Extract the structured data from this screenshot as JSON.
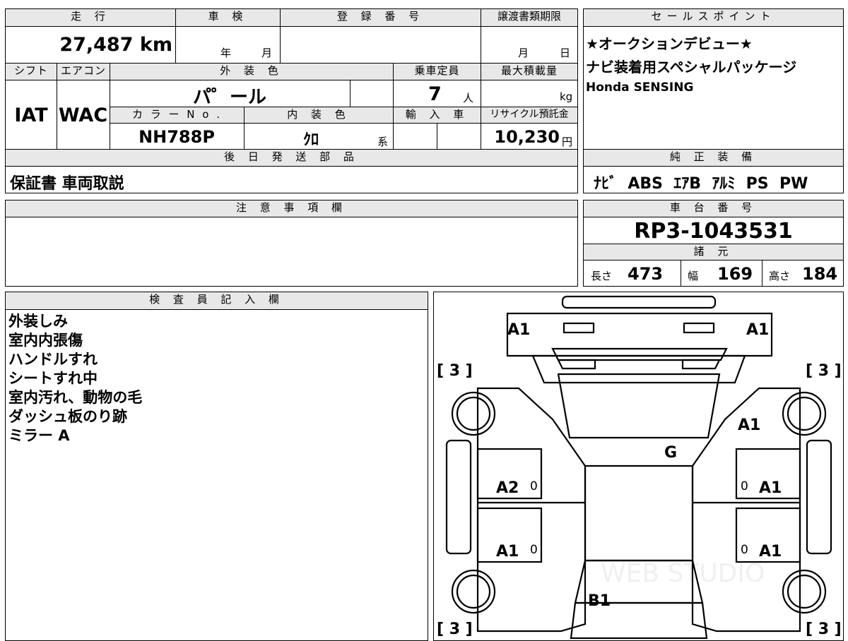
{
  "left_table": {
    "mileage_label": "走 行",
    "mileage_value": "27,487 km",
    "shaken_label": "車 検",
    "shaken_year_unit": "年",
    "shaken_month_unit": "月",
    "reg_label": "登 録 番 号",
    "transfer_label": "譲渡書類期限",
    "transfer_month_unit": "月",
    "transfer_day_unit": "日",
    "shift_label": "シフト",
    "shift_value": "IAT",
    "ac_label": "エアコン",
    "ac_value": "WAC",
    "exterior_label": "外 装 色",
    "exterior_value": "パ゜ール",
    "capacity_label": "乗車定員",
    "capacity_value": "7",
    "capacity_unit": "人",
    "maxload_label": "最大積載量",
    "maxload_unit": "kg",
    "color_no_label": "カ ラ ー N o .",
    "color_no_value": "NH788P",
    "interior_label": "内 装 色",
    "interior_value": "ｸﾛ",
    "interior_unit": "系",
    "import_label": "輸 入 車",
    "recycle_label": "リサイクル預託金",
    "recycle_value": "10,230",
    "recycle_unit": "円",
    "later_parts_label": "後 日 発 送 部 品",
    "later_parts_value": "保証書 車両取説"
  },
  "sales": {
    "label": "セールスポイント",
    "lines": [
      "★オークションデビュー★",
      "ナビ装着用スペシャルパッケージ",
      "Honda SENSING"
    ]
  },
  "equipment": {
    "label": "純 正 装 備",
    "value": "ﾅﾋﾞ  ABS  ｴｱB  ｱﾙﾐ  PS  PW"
  },
  "caution": {
    "label": "注 意 事 項 欄"
  },
  "chassis": {
    "label": "車 台 番 号",
    "value": "RP3-1043531",
    "dims_label": "諸 元",
    "length_label": "長さ",
    "length_value": "473",
    "width_label": "幅",
    "width_value": "169",
    "height_label": "高さ",
    "height_value": "184"
  },
  "inspector": {
    "label": "検 査 員 記 入 欄",
    "lines": [
      "外装しみ",
      "室内内張傷",
      "ハンドルすれ",
      "シートすれ中",
      "室内汚れ、動物の毛",
      "ダッシュ板のり跡",
      "ミラー A"
    ]
  },
  "diagram": {
    "front_left": "A1",
    "front_right": "A1",
    "right_fender": "A1",
    "windshield": "G",
    "left_front_door": "A2",
    "right_front_door": "A1",
    "left_rear_door": "A1",
    "right_rear_door": "A1",
    "rear": "B1",
    "tire_fl": "[ 3 ]",
    "tire_fr": "[ 3 ]",
    "tire_rl": "[ 3 ]",
    "tire_rr": "[ 3 ]",
    "door_mark_lf": "0",
    "door_mark_rf": "0",
    "door_mark_lr": "0",
    "door_mark_rr": "0",
    "watermark": "WEB STUDIO"
  }
}
